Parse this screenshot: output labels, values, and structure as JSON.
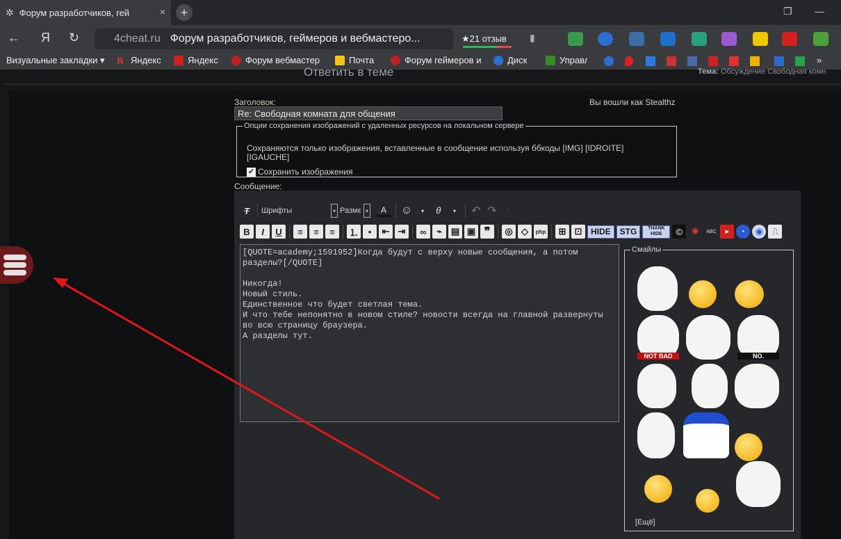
{
  "tab": {
    "title": "Форум разработчиков, гей",
    "close_glyph": "×",
    "new_glyph": "+"
  },
  "nav": {
    "back_glyph": "←",
    "yandex_glyph": "Я",
    "reload_glyph": "↻",
    "domain": "4cheat.ru",
    "page_title": "Форум разработчиков, геймеров и вебмастеро...",
    "reviews": "★21 отзыв"
  },
  "bookmarks": [
    {
      "label": "Визуальные закладки ▾",
      "icon": "none"
    },
    {
      "label": "Яндекс",
      "icon": "yandex-icon"
    },
    {
      "label": "Яндекс",
      "icon": "yandex-icon"
    },
    {
      "label": "Форум вебмастер",
      "icon": "forum-icon"
    },
    {
      "label": "Почта",
      "icon": "mail-icon"
    },
    {
      "label": "Форум геймеров и",
      "icon": "forum-icon"
    },
    {
      "label": "Диск",
      "icon": "disk-icon"
    },
    {
      "label": "Управл",
      "icon": "manage-icon"
    },
    {
      "label": "»",
      "icon": "none"
    }
  ],
  "page": {
    "heading": "Ответить в теме",
    "topic_label": "Тема:",
    "topic_value": "Обсуждение Свободная комн",
    "title_label": "Заголовок:",
    "logged_in": "Вы вошли как Stealthz",
    "title_value": "Re: Свободная комната для общения",
    "options_legend": "Опции сохранения изображений с удаленных ресурсов на локальном сервере",
    "options_text": "Сохраняются только изображения, вставленные в сообщение используя ббкоды [IMG] [IDROITE] [IGAUCHE]",
    "save_images_label": "Сохранить изображения",
    "message_label": "Сообщение:"
  },
  "editor": {
    "fonts_label": "Шрифты",
    "size_label": "Разме",
    "tags": [
      "HIDE",
      "STG",
      "THANK HIDE"
    ],
    "message_text": "[QUOTE=academy;1591952]Когда будут с верху новые сообщения, а потом разделы?[/QUOTE]\n\nНикогда!\nНовый стиль.\nЕдинственное что будет светлая тема.\nИ что тебе непонятно в новом стиле? новости всегда на главной развернуты во всю страницу браузера.\nА разделы тут.",
    "smilies_legend": "Смайлы",
    "more_label": "[Ещё]",
    "smilies": [
      {
        "name": "cool-face",
        "caption": ""
      },
      {
        "name": "dreadlock-smiley",
        "caption": ""
      },
      {
        "name": "angry-smiley",
        "caption": ""
      },
      {
        "name": "not-bad-face",
        "caption": "NOT BAD"
      },
      {
        "name": "shrug-ghost-face",
        "caption": ""
      },
      {
        "name": "no-face",
        "caption": "NO."
      },
      {
        "name": "thinking-face",
        "caption": ""
      },
      {
        "name": "okay-face",
        "caption": ""
      },
      {
        "name": "thumbs-up-face",
        "caption": ""
      },
      {
        "name": "smiling-man-face",
        "caption": ""
      },
      {
        "name": "dolan-duck",
        "caption": ""
      },
      {
        "name": "dreadlock-smiley",
        "caption": ""
      },
      {
        "name": "crying-smiley",
        "caption": ""
      },
      {
        "name": "love-smiley",
        "caption": ""
      },
      {
        "name": "happy-face",
        "caption": ""
      }
    ]
  },
  "colors": {
    "accent_red": "#e3171b",
    "menu_btn": "#6b1a1d"
  }
}
